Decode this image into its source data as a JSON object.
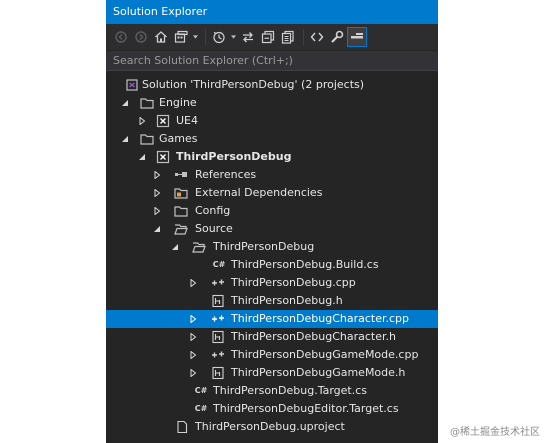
{
  "window": {
    "title": "Solution Explorer"
  },
  "toolbar": {
    "buttons": [
      "back-icon",
      "forward-icon",
      "home-icon",
      "switch-views-icon",
      "pending-changes-icon",
      "sync-icon",
      "collapse-all-icon",
      "show-all-files-icon",
      "code-view-icon",
      "properties-icon",
      "preview-icon"
    ]
  },
  "search": {
    "placeholder": "Search Solution Explorer (Ctrl+;)"
  },
  "tree": {
    "solution": "Solution 'ThirdPersonDebug' (2 projects)",
    "engine_folder": "Engine",
    "ue4_project": "UE4",
    "games_folder": "Games",
    "game_project": "ThirdPersonDebug",
    "references": "References",
    "external_dependencies": "External Dependencies",
    "config": "Config",
    "source": "Source",
    "source_subfolder": "ThirdPersonDebug",
    "files": {
      "build_cs": "ThirdPersonDebug.Build.cs",
      "main_cpp": "ThirdPersonDebug.cpp",
      "main_h": "ThirdPersonDebug.h",
      "character_cpp": "ThirdPersonDebugCharacter.cpp",
      "character_h": "ThirdPersonDebugCharacter.h",
      "gamemode_cpp": "ThirdPersonDebugGameMode.cpp",
      "gamemode_h": "ThirdPersonDebugGameMode.h",
      "target_cs": "ThirdPersonDebug.Target.cs",
      "editor_target_cs": "ThirdPersonDebugEditor.Target.cs",
      "uproject": "ThirdPersonDebug.uproject"
    },
    "selected_item": "ThirdPersonDebugCharacter.cpp"
  },
  "icon_labels": {
    "csharp": "C#"
  },
  "watermark": "@稀土掘金技术社区",
  "colors": {
    "title_bar": "#007acc",
    "panel_background": "#252526",
    "selection": "#007acc",
    "text": "#e6e6e6"
  }
}
